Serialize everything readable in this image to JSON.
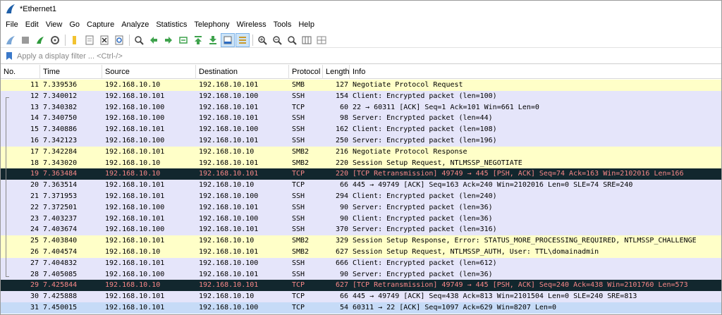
{
  "window": {
    "title": "*Ethernet1"
  },
  "menu": [
    "File",
    "Edit",
    "View",
    "Go",
    "Capture",
    "Analyze",
    "Statistics",
    "Telephony",
    "Wireless",
    "Tools",
    "Help"
  ],
  "filter": {
    "placeholder": "Apply a display filter ... <Ctrl-/>",
    "value": ""
  },
  "columns": [
    "No.",
    "Time",
    "Source",
    "Destination",
    "Protocol",
    "Length",
    "Info"
  ],
  "colors": {
    "smb": "#ffffc8",
    "ssh": "#e5e5fa",
    "bad_bg": "#12272e",
    "bad_fg": "#f78787",
    "selected": "#c6dbf7"
  },
  "packets": [
    {
      "no": "11",
      "time": "7.339536",
      "src": "192.168.10.10",
      "dst": "192.168.10.101",
      "proto": "SMB",
      "len": "127",
      "info": "Negotiate Protocol Request",
      "style": "smb"
    },
    {
      "no": "12",
      "time": "7.340012",
      "src": "192.168.10.101",
      "dst": "192.168.10.100",
      "proto": "SSH",
      "len": "154",
      "info": "Client: Encrypted packet (len=100)",
      "style": "ssh"
    },
    {
      "no": "13",
      "time": "7.340382",
      "src": "192.168.10.100",
      "dst": "192.168.10.101",
      "proto": "TCP",
      "len": "60",
      "info": "22 → 60311 [ACK] Seq=1 Ack=101 Win=661 Len=0",
      "style": "tcp"
    },
    {
      "no": "14",
      "time": "7.340750",
      "src": "192.168.10.100",
      "dst": "192.168.10.101",
      "proto": "SSH",
      "len": "98",
      "info": "Server: Encrypted packet (len=44)",
      "style": "ssh"
    },
    {
      "no": "15",
      "time": "7.340886",
      "src": "192.168.10.101",
      "dst": "192.168.10.100",
      "proto": "SSH",
      "len": "162",
      "info": "Client: Encrypted packet (len=108)",
      "style": "ssh"
    },
    {
      "no": "16",
      "time": "7.342123",
      "src": "192.168.10.100",
      "dst": "192.168.10.101",
      "proto": "SSH",
      "len": "250",
      "info": "Server: Encrypted packet (len=196)",
      "style": "ssh"
    },
    {
      "no": "17",
      "time": "7.342284",
      "src": "192.168.10.101",
      "dst": "192.168.10.10",
      "proto": "SMB2",
      "len": "216",
      "info": "Negotiate Protocol Response",
      "style": "smb"
    },
    {
      "no": "18",
      "time": "7.343020",
      "src": "192.168.10.10",
      "dst": "192.168.10.101",
      "proto": "SMB2",
      "len": "220",
      "info": "Session Setup Request, NTLMSSP_NEGOTIATE",
      "style": "smb"
    },
    {
      "no": "19",
      "time": "7.363484",
      "src": "192.168.10.10",
      "dst": "192.168.10.101",
      "proto": "TCP",
      "len": "220",
      "info": "[TCP Retransmission] 49749 → 445 [PSH, ACK] Seq=74 Ack=163 Win=2102016 Len=166",
      "style": "bad"
    },
    {
      "no": "20",
      "time": "7.363514",
      "src": "192.168.10.101",
      "dst": "192.168.10.10",
      "proto": "TCP",
      "len": "66",
      "info": "445 → 49749 [ACK] Seq=163 Ack=240 Win=2102016 Len=0 SLE=74 SRE=240",
      "style": "tcp"
    },
    {
      "no": "21",
      "time": "7.371953",
      "src": "192.168.10.101",
      "dst": "192.168.10.100",
      "proto": "SSH",
      "len": "294",
      "info": "Client: Encrypted packet (len=240)",
      "style": "ssh"
    },
    {
      "no": "22",
      "time": "7.372501",
      "src": "192.168.10.100",
      "dst": "192.168.10.101",
      "proto": "SSH",
      "len": "90",
      "info": "Server: Encrypted packet (len=36)",
      "style": "ssh"
    },
    {
      "no": "23",
      "time": "7.403237",
      "src": "192.168.10.101",
      "dst": "192.168.10.100",
      "proto": "SSH",
      "len": "90",
      "info": "Client: Encrypted packet (len=36)",
      "style": "ssh"
    },
    {
      "no": "24",
      "time": "7.403674",
      "src": "192.168.10.100",
      "dst": "192.168.10.101",
      "proto": "SSH",
      "len": "370",
      "info": "Server: Encrypted packet (len=316)",
      "style": "ssh"
    },
    {
      "no": "25",
      "time": "7.403840",
      "src": "192.168.10.101",
      "dst": "192.168.10.10",
      "proto": "SMB2",
      "len": "329",
      "info": "Session Setup Response, Error: STATUS_MORE_PROCESSING_REQUIRED, NTLMSSP_CHALLENGE",
      "style": "smb"
    },
    {
      "no": "26",
      "time": "7.404574",
      "src": "192.168.10.10",
      "dst": "192.168.10.101",
      "proto": "SMB2",
      "len": "627",
      "info": "Session Setup Request, NTLMSSP_AUTH, User: TTL\\domainadmin",
      "style": "smb"
    },
    {
      "no": "27",
      "time": "7.404832",
      "src": "192.168.10.101",
      "dst": "192.168.10.100",
      "proto": "SSH",
      "len": "666",
      "info": "Client: Encrypted packet (len=612)",
      "style": "ssh"
    },
    {
      "no": "28",
      "time": "7.405085",
      "src": "192.168.10.100",
      "dst": "192.168.10.101",
      "proto": "SSH",
      "len": "90",
      "info": "Server: Encrypted packet (len=36)",
      "style": "ssh"
    },
    {
      "no": "29",
      "time": "7.425844",
      "src": "192.168.10.10",
      "dst": "192.168.10.101",
      "proto": "TCP",
      "len": "627",
      "info": "[TCP Retransmission] 49749 → 445 [PSH, ACK] Seq=240 Ack=438 Win=2101760 Len=573",
      "style": "bad"
    },
    {
      "no": "30",
      "time": "7.425888",
      "src": "192.168.10.101",
      "dst": "192.168.10.10",
      "proto": "TCP",
      "len": "66",
      "info": "445 → 49749 [ACK] Seq=438 Ack=813 Win=2101504 Len=0 SLE=240 SRE=813",
      "style": "tcp"
    },
    {
      "no": "31",
      "time": "7.450015",
      "src": "192.168.10.101",
      "dst": "192.168.10.100",
      "proto": "TCP",
      "len": "54",
      "info": "60311 → 22 [ACK] Seq=1097 Ack=629 Win=8207 Len=0",
      "style": "sel"
    }
  ]
}
